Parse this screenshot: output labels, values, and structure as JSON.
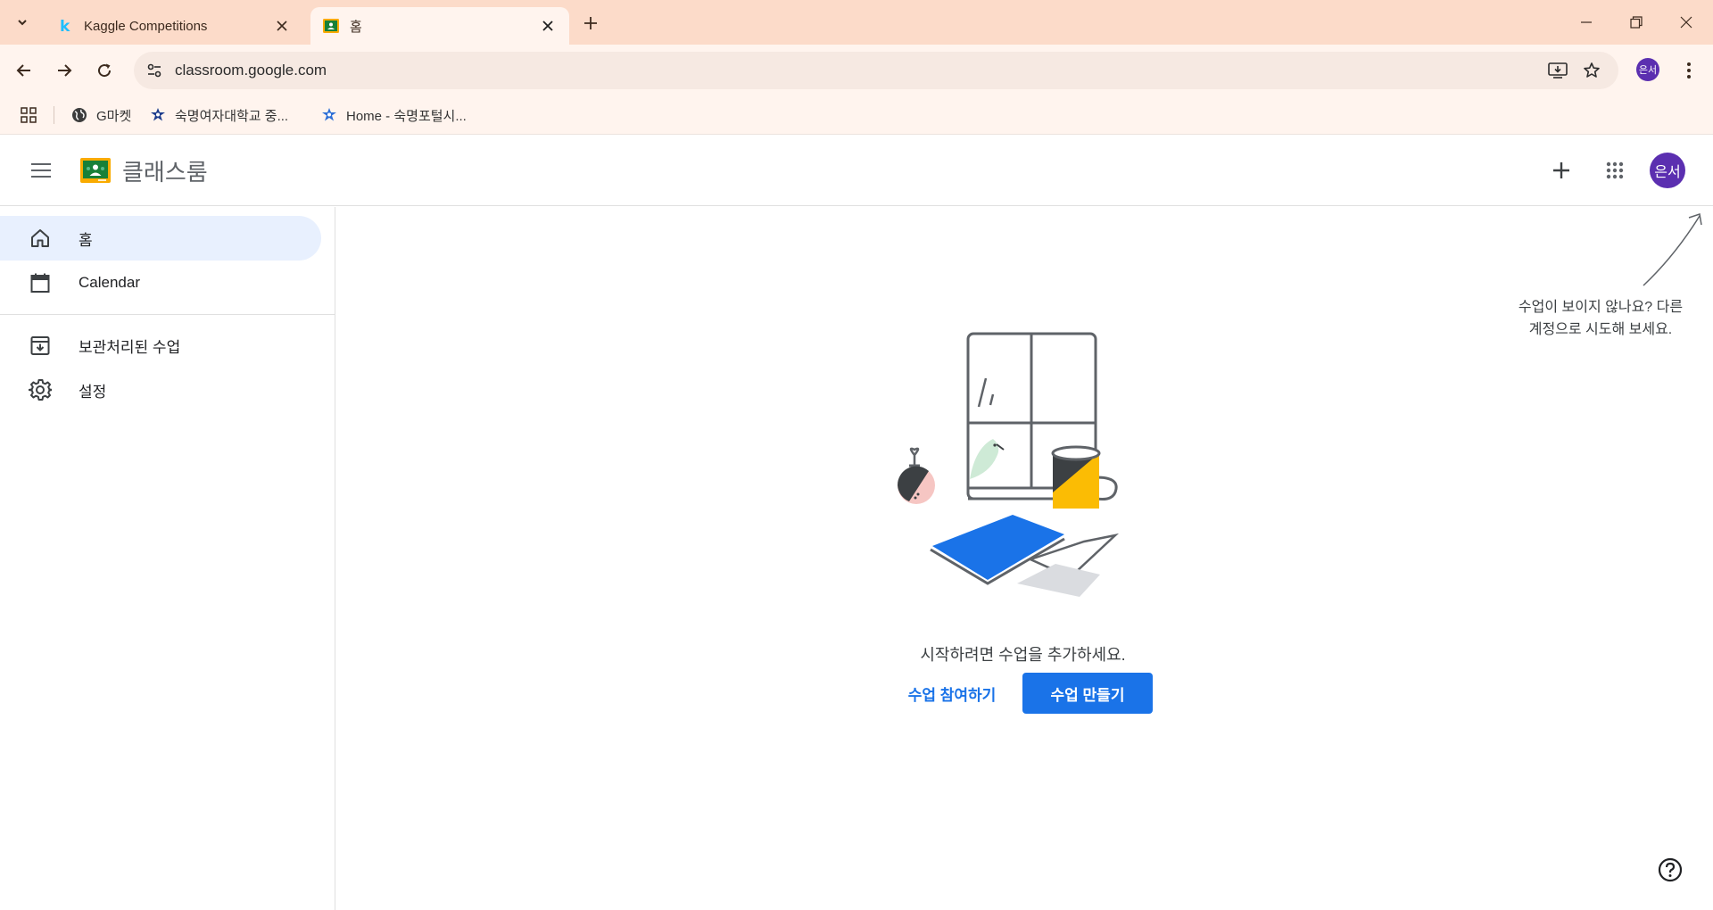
{
  "browser": {
    "tabs": [
      {
        "title": "Kaggle Competitions",
        "favicon": "kaggle-icon",
        "active": false
      },
      {
        "title": "홈",
        "favicon": "classroom-icon",
        "active": true
      }
    ],
    "url": "classroom.google.com",
    "profile_initials": "은서",
    "bookmarks": [
      {
        "label": "G마켓",
        "icon": "globe-icon"
      },
      {
        "label": "숙명여자대학교 중...",
        "icon": "sookmyung-icon"
      },
      {
        "label": "Home - 숙명포털시...",
        "icon": "sookmyung-icon"
      }
    ]
  },
  "app": {
    "name": "클래스룸",
    "avatar_initials": "은서",
    "colors": {
      "accent": "#1a73e8",
      "avatar": "#5b2fb0",
      "active_nav": "#e8f0fe",
      "tab_strip": "#fcdbc9"
    }
  },
  "sidebar": {
    "items": [
      {
        "label": "홈",
        "icon": "home-icon",
        "active": true
      },
      {
        "label": "Calendar",
        "icon": "calendar-icon",
        "active": false
      },
      {
        "label": "보관처리된 수업",
        "icon": "archive-icon",
        "active": false
      },
      {
        "label": "설정",
        "icon": "gear-icon",
        "active": false
      }
    ]
  },
  "main": {
    "empty_message": "시작하려면 수업을 추가하세요.",
    "join_label": "수업 참여하기",
    "create_label": "수업 만들기",
    "hint_line1": "수업이 보이지 않나요? 다른",
    "hint_line2": "계정으로 시도해 보세요."
  }
}
